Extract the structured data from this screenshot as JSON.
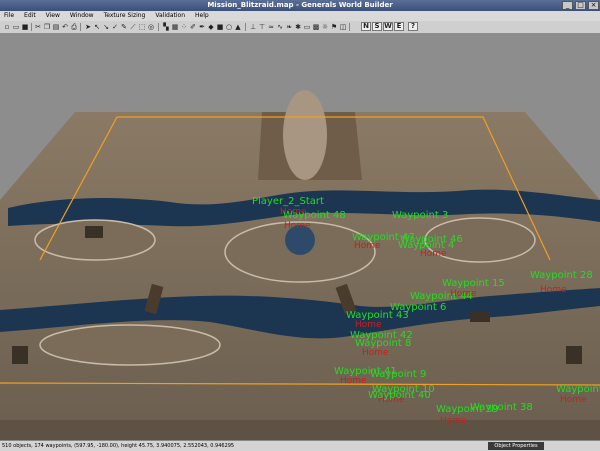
{
  "window": {
    "title": "Mission_Blitzraid.map - Generals World Builder",
    "buttons": {
      "minimize": "_",
      "maximize": "□",
      "close": "×"
    }
  },
  "menu": [
    "File",
    "Edit",
    "View",
    "Window",
    "Texture Sizing",
    "Validation",
    "Help"
  ],
  "toolbar": {
    "dirs": [
      "N",
      "S",
      "W",
      "E"
    ],
    "help": "?"
  },
  "status": {
    "text": "510 objects, 174 waypoints, (597.95, -180.00), height 45.75, 3.940075, 2.552043, 0.946295",
    "panel": "Object Properties"
  },
  "map": {
    "waypoints": [
      {
        "name": "Player_2_Start",
        "team": "Home"
      },
      {
        "name": "Waypoint 48",
        "team": "Home"
      },
      {
        "name": "Waypoint 3",
        "team": ""
      },
      {
        "name": "Waypoint 47",
        "team": "Home"
      },
      {
        "name": "Waypoint 46",
        "team": ""
      },
      {
        "name": "Waypoint 4",
        "team": "Home"
      },
      {
        "name": "Waypoint 15",
        "team": ""
      },
      {
        "name": "Waypoint 44",
        "team": "Home"
      },
      {
        "name": "Waypoint 6",
        "team": ""
      },
      {
        "name": "Waypoint 43",
        "team": "Home"
      },
      {
        "name": "Waypoint 42",
        "team": ""
      },
      {
        "name": "Waypoint 8",
        "team": "Home"
      },
      {
        "name": "Waypoint 41",
        "team": "Home"
      },
      {
        "name": "Waypoint 9",
        "team": ""
      },
      {
        "name": "Waypoint 10",
        "team": "Home"
      },
      {
        "name": "Waypoint 40",
        "team": ""
      },
      {
        "name": "Waypoint 39",
        "team": "Home"
      },
      {
        "name": "Waypoint 38",
        "team": ""
      },
      {
        "name": "Waypoint",
        "team": "Home"
      },
      {
        "name": "Waypoint 28",
        "team": "Home"
      }
    ]
  }
}
